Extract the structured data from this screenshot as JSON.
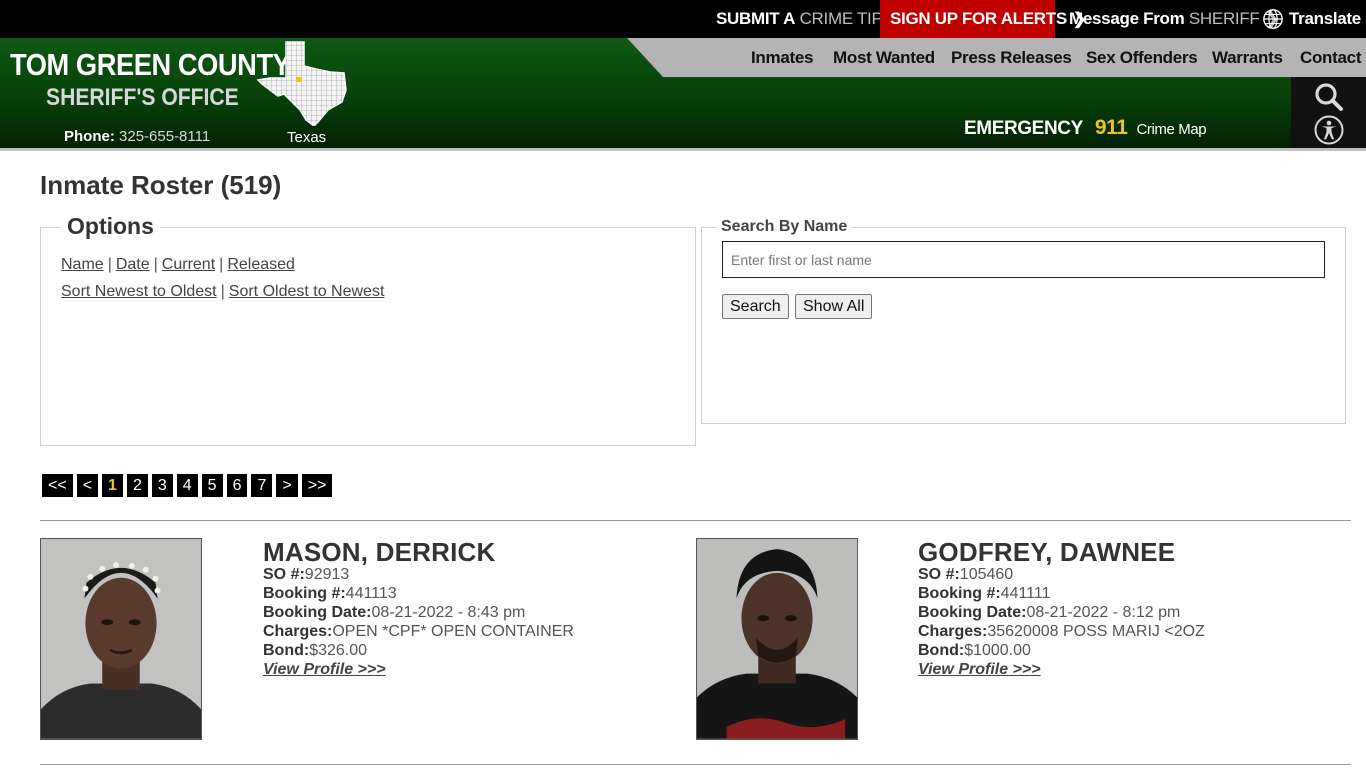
{
  "topbar": {
    "crime_tip_a": "SUBMIT A",
    "crime_tip_b": "CRIME TIP",
    "alerts": "SIGN UP FOR ALERTS",
    "sheriff_a": "Message From",
    "sheriff_b": "SHERIFF",
    "translate": "Translate"
  },
  "brand": {
    "line1": "TOM GREEN COUNTY",
    "line2": "SHERIFF'S OFFICE",
    "phone_label": "Phone:",
    "phone_number": "325-655-8111",
    "state_label": "Texas"
  },
  "nav": {
    "items": [
      "Inmates",
      "Most Wanted",
      "Press Releases",
      "Sex Offenders",
      "Warrants",
      "Contact"
    ]
  },
  "emergency": {
    "label": "EMERGENCY",
    "number": "911",
    "crime_map": "Crime Map"
  },
  "page": {
    "title": "Inmate Roster (519)"
  },
  "options": {
    "legend": "Options",
    "row1": [
      "Name",
      "Date",
      "Current",
      "Released"
    ],
    "row2": [
      "Sort Newest to Oldest",
      "Sort Oldest to Newest"
    ],
    "separator": "|"
  },
  "search": {
    "legend": "Search By Name",
    "placeholder": "Enter first or last name",
    "search_button": "Search",
    "show_all_button": "Show All"
  },
  "pager": {
    "first": "<<",
    "prev": "<",
    "pages": [
      "1",
      "2",
      "3",
      "4",
      "5",
      "6",
      "7"
    ],
    "current": "1",
    "next": ">",
    "last": ">>"
  },
  "labels": {
    "so": "SO #:",
    "booking": "Booking #:",
    "booking_date": "Booking Date:",
    "charges": "Charges:",
    "bond": "Bond:",
    "view_profile": "View Profile >>>"
  },
  "inmates": [
    {
      "name": "MASON, DERRICK",
      "so": "92913",
      "booking": "441113",
      "booking_date": "08-21-2022 - 8:43 pm",
      "charges": "OPEN *CPF* OPEN CONTAINER",
      "bond": "$326.00"
    },
    {
      "name": "GODFREY, DAWNEE",
      "so": "105460",
      "booking": "441111",
      "booking_date": "08-21-2022 - 8:12 pm",
      "charges": "35620008 POSS MARIJ <2OZ",
      "bond": "$1000.00"
    }
  ],
  "colors": {
    "top_bar": "#000000",
    "alerts_red": "#c00000",
    "header_green": "#0e5a12",
    "nav_grey": "#b4b4b4",
    "accent_gold": "#f0c419"
  }
}
